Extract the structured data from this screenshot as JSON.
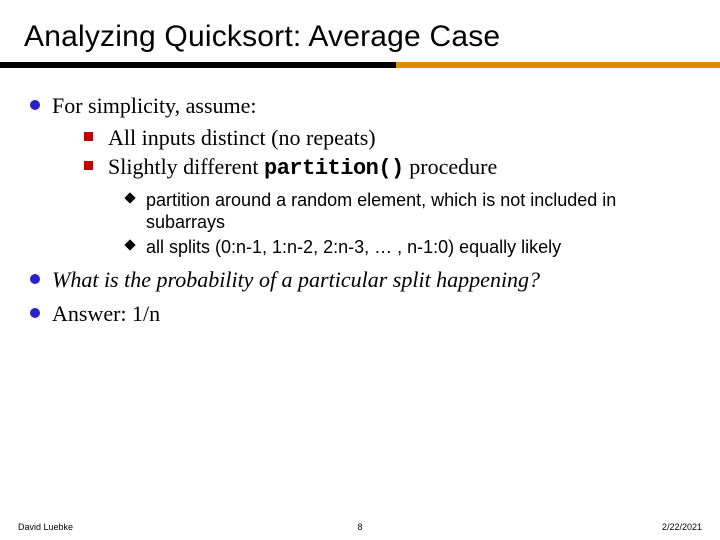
{
  "title": "Analyzing Quicksort: Average Case",
  "items": [
    {
      "text": "For simplicity, assume:",
      "italic": false
    },
    {
      "text_before": "Slightly different ",
      "code": "partition()",
      "text_after": " procedure"
    }
  ],
  "sub1": "All inputs distinct (no repeats)",
  "sub2_before": "Slightly different ",
  "sub2_code": "partition()",
  "sub2_after": "  procedure",
  "sub3a": "partition around a random element, which is not included in subarrays",
  "sub3b": "all splits (0:n-1, 1:n-2, 2:n-3, … , n-1:0) equally likely",
  "q": "What is the probability of a particular split happening?",
  "ans": "Answer: 1/n",
  "footer": {
    "author": "David Luebke",
    "page": "8",
    "date": "2/22/2021"
  }
}
